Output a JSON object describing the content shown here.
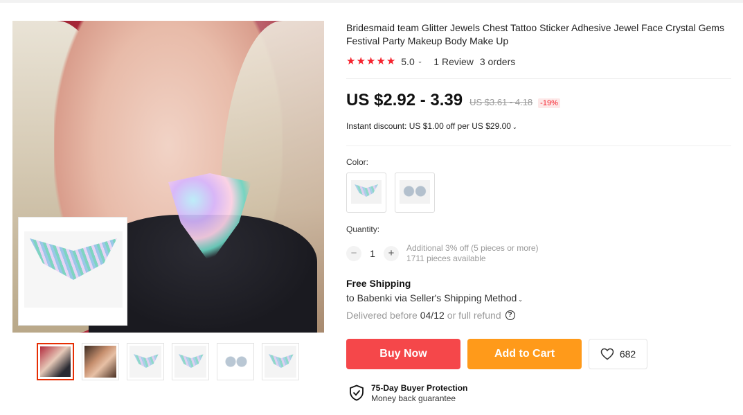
{
  "product": {
    "title": "Bridesmaid team Glitter Jewels Chest Tattoo Sticker Adhesive Jewel Face Crystal Gems Festival Party Makeup Body Make Up",
    "rating": "5.0",
    "reviews": "1 Review",
    "orders": "3 orders",
    "price": "US $2.92 - 3.39",
    "old_price": "US $3.61 - 4.18",
    "discount": "-19%",
    "instant_discount": "Instant discount: US $1.00 off per US $29.00"
  },
  "colors": {
    "label": "Color:",
    "options": [
      "chest-gem-sheet",
      "round-gem-sheet"
    ]
  },
  "quantity": {
    "label": "Quantity:",
    "minus": "−",
    "value": "1",
    "plus": "+",
    "note_line1": "Additional 3% off (5 pieces or more)",
    "note_line2": "1711 pieces available"
  },
  "shipping": {
    "title": "Free Shipping",
    "to": "to Babenki via Seller's Shipping Method",
    "delivered_prefix": "Delivered before",
    "delivered_date": "04/12",
    "delivered_suffix": "or full refund"
  },
  "actions": {
    "buy_now": "Buy Now",
    "add_to_cart": "Add to Cart",
    "wishlist_count": "682"
  },
  "protection": {
    "title": "75-Day Buyer Protection",
    "subtitle": "Money back guarantee"
  },
  "gallery": {
    "thumbnails": [
      "photo-model-front",
      "photo-model-necklace",
      "sheet-chest-gem",
      "sheet-small-gem",
      "sheet-round-gem",
      "sheet-chest-gem-2"
    ],
    "active_index": 0
  },
  "icons": {
    "star": "star-icon",
    "chevron": "chevron-down-icon",
    "help": "question-icon",
    "heart": "heart-icon",
    "shield": "shield-check-icon"
  },
  "colors_theme": {
    "accent_red": "#f5474a",
    "accent_orange": "#ff9a1a",
    "star_red": "#f5222d",
    "active_thumb_border": "#e62e04"
  }
}
